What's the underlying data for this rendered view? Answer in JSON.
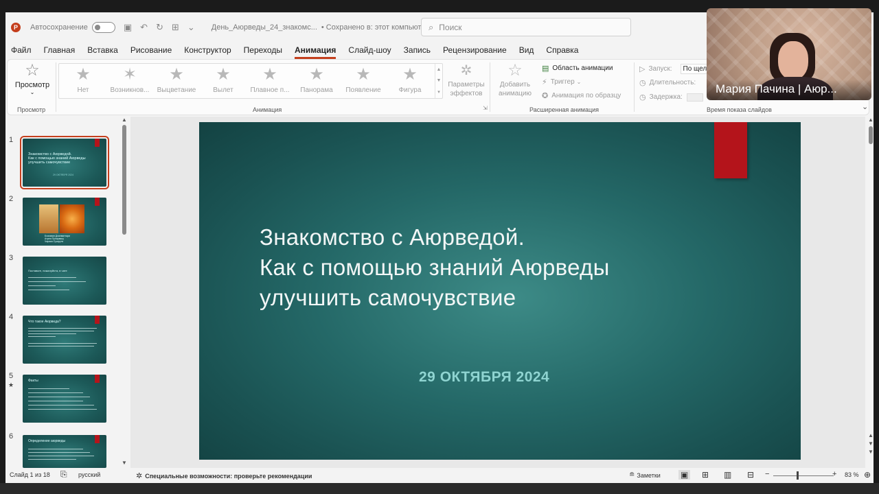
{
  "titlebar": {
    "logo": "P",
    "autosave_label": "Автосохранение",
    "doc_name": "День_Аюрведы_24_знакомс...",
    "saved_status": "• Сохранено в: этот компьютер",
    "search_placeholder": "Поиск"
  },
  "menu_tabs": [
    {
      "label": "Файл",
      "active": false
    },
    {
      "label": "Главная",
      "active": false
    },
    {
      "label": "Вставка",
      "active": false
    },
    {
      "label": "Рисование",
      "active": false
    },
    {
      "label": "Конструктор",
      "active": false
    },
    {
      "label": "Переходы",
      "active": false
    },
    {
      "label": "Анимация",
      "active": true
    },
    {
      "label": "Слайд-шоу",
      "active": false
    },
    {
      "label": "Запись",
      "active": false
    },
    {
      "label": "Рецензирование",
      "active": false
    },
    {
      "label": "Вид",
      "active": false
    },
    {
      "label": "Справка",
      "active": false
    }
  ],
  "ribbon": {
    "preview": {
      "label": "Просмотр",
      "group": "Просмотр"
    },
    "animation_group": "Анимация",
    "animations": [
      {
        "label": "Нет"
      },
      {
        "label": "Возникнов..."
      },
      {
        "label": "Выцветание"
      },
      {
        "label": "Вылет"
      },
      {
        "label": "Плавное п..."
      },
      {
        "label": "Панорама"
      },
      {
        "label": "Появление"
      },
      {
        "label": "Фигура"
      }
    ],
    "effect_params": "Параметры эффектов",
    "add_animation": "Добавить анимацию",
    "advanced_group": "Расширенная анимация",
    "animation_pane": "Область анимации",
    "trigger": "Триггер",
    "animation_painter": "Анимация по образцу",
    "timing_group": "Время показа слайдов",
    "start_label": "Запуск:",
    "start_value": "По щел",
    "duration_label": "Длительность:",
    "delay_label": "Задержка:"
  },
  "webcam": {
    "name": "Мария Пачина | Аюр..."
  },
  "thumbnails": [
    {
      "num": "1",
      "selected": true,
      "text": "Знакомство с Аюрведой.\nКак с помощью знаний Аюрведы\nулучшить самочувствие",
      "date": "29 ОКТЯБРЯ 2024"
    },
    {
      "num": "2",
      "selected": false,
      "text": "Бхагаван Дханвантари\nАтрея Пунарвасу\nЧарака Сушрута"
    },
    {
      "num": "3",
      "selected": false,
      "text": "Поставьте, пожалуйста, в чате"
    },
    {
      "num": "4",
      "selected": false,
      "text": "Что такое Аюрведа?"
    },
    {
      "num": "5",
      "selected": false,
      "star": "★",
      "text": "Факты"
    },
    {
      "num": "6",
      "selected": false,
      "text": "Определение аюрведы"
    }
  ],
  "slide": {
    "title_lines": [
      "Знакомство с Аюрведой.",
      "Как с помощью знаний Аюрведы",
      "улучшить самочувствие"
    ],
    "date": "29 ОКТЯБРЯ 2024"
  },
  "statusbar": {
    "slide_counter": "Слайд 1 из 18",
    "language": "русский",
    "accessibility": "Специальные возможности: проверьте рекомендации",
    "notes": "Заметки",
    "zoom": "83 %"
  },
  "colors": {
    "accent": "#c43e1c",
    "slide_bg": "#246867",
    "slide_ribbon": "#b4141b",
    "slide_date": "#8fd4d1"
  }
}
